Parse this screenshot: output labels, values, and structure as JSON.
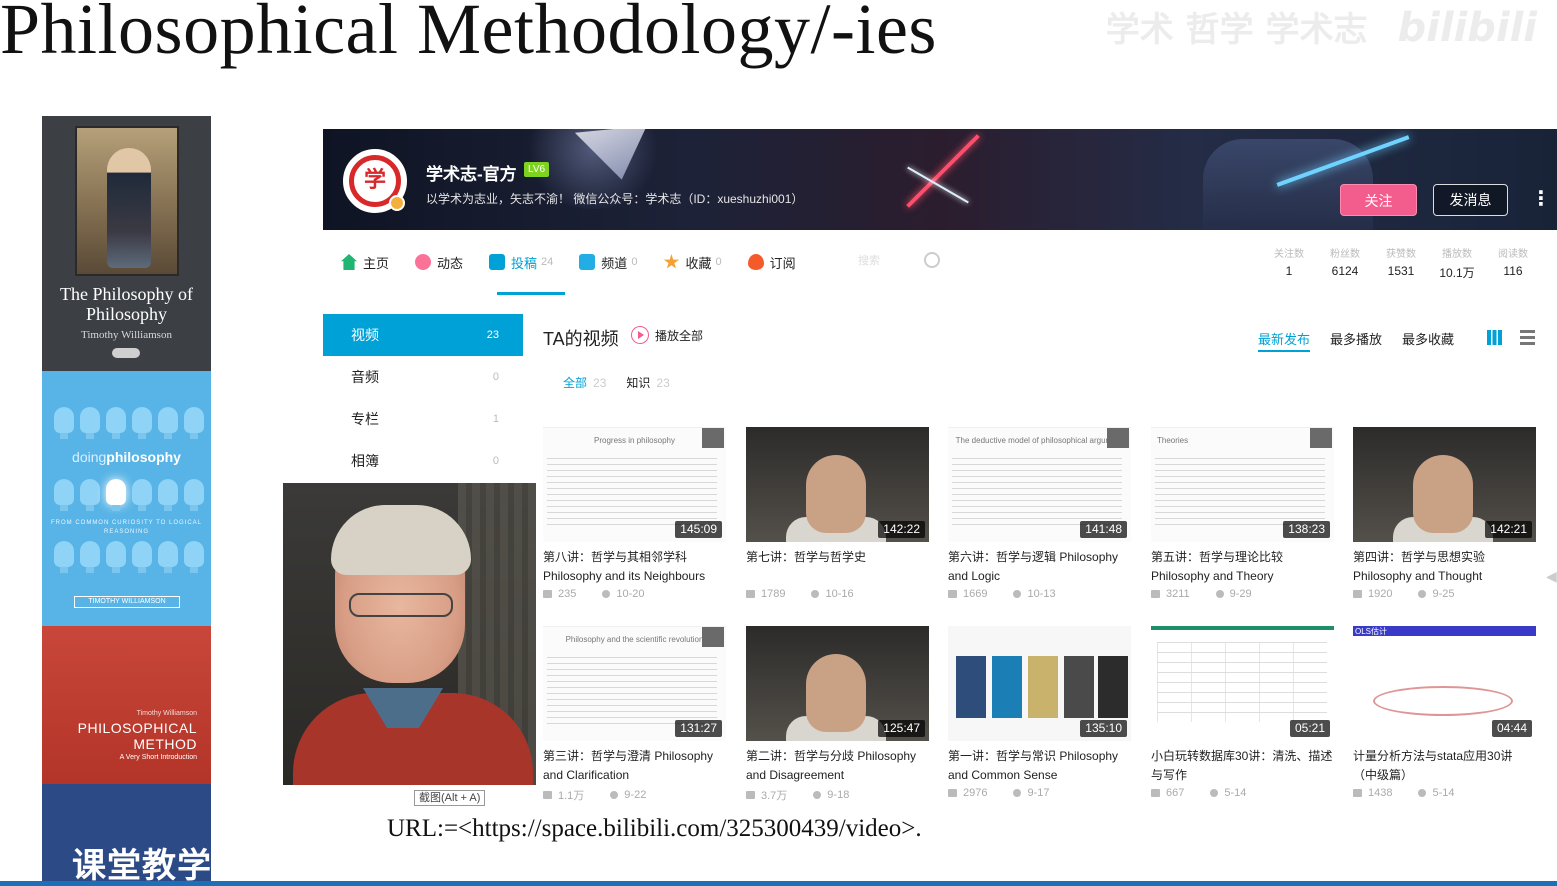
{
  "slide": {
    "title": "Philosophical Methodology/-ies",
    "watermark_text": "学术 哲学 学术志",
    "watermark_logo": "bilibili",
    "url_line": "URL:=<https://space.bilibili.com/325300439/video>."
  },
  "books": [
    {
      "title": "The Philosophy of Philosophy",
      "author": "Timothy Williamson"
    },
    {
      "title_prefix": "doing",
      "title_main": "philosophy",
      "subtitle": "FROM COMMON CURIOSITY TO LOGICAL REASONING",
      "author": "TIMOTHY WILLIAMSON"
    },
    {
      "author": "Timothy Williamson",
      "title": "PHILOSOPHICAL METHOD",
      "subtitle": "A Very Short Introduction"
    },
    {
      "title": "课堂教学"
    }
  ],
  "channel": {
    "avatar_char": "学",
    "name": "学术志-官方",
    "level": "LV6",
    "sign": "以学术为志业，矢志不渝！ 微信公众号：学术志（ID：xueshuzhi001）",
    "follow_label": "关注",
    "message_label": "发消息",
    "more_label": "⋮"
  },
  "nav": {
    "items": [
      {
        "label": "主页",
        "count": "",
        "icon": "home-icon",
        "active": false
      },
      {
        "label": "动态",
        "count": "",
        "icon": "dynamic-icon",
        "active": false
      },
      {
        "label": "投稿",
        "count": "24",
        "icon": "post-icon",
        "active": true
      },
      {
        "label": "频道",
        "count": "0",
        "icon": "channel-icon",
        "active": false
      },
      {
        "label": "收藏",
        "count": "0",
        "icon": "favorite-icon",
        "active": false
      },
      {
        "label": "订阅",
        "count": "",
        "icon": "subscribe-icon",
        "active": false
      }
    ],
    "search_placeholder": "搜索"
  },
  "stats": [
    {
      "label": "关注数",
      "value": "1"
    },
    {
      "label": "粉丝数",
      "value": "6124"
    },
    {
      "label": "获赞数",
      "value": "1531"
    },
    {
      "label": "播放数",
      "value": "10.1万"
    },
    {
      "label": "阅读数",
      "value": "116"
    }
  ],
  "sidebar": {
    "items": [
      {
        "label": "视频",
        "count": "23",
        "active": true
      },
      {
        "label": "音频",
        "count": "0",
        "active": false
      },
      {
        "label": "专栏",
        "count": "1",
        "active": false
      },
      {
        "label": "相簿",
        "count": "0",
        "active": false
      }
    ]
  },
  "videos_header": {
    "title": "TA的视频",
    "play_all": "播放全部",
    "sort": [
      "最新发布",
      "最多播放",
      "最多收藏"
    ],
    "filters": [
      {
        "label": "全部",
        "count": "23"
      },
      {
        "label": "知识",
        "count": "23"
      }
    ]
  },
  "videos": [
    {
      "title": "第八讲：哲学与其相邻学科 Philosophy and its Neighbours",
      "duration": "145:09",
      "views": "235",
      "date": "10-20",
      "thumb": "doc",
      "thumb_text": "Progress in philosophy"
    },
    {
      "title": "第七讲：哲学与哲学史",
      "duration": "142:22",
      "views": "1789",
      "date": "10-16",
      "thumb": "video",
      "thumb_text": ""
    },
    {
      "title": "第六讲：哲学与逻辑 Philosophy and Logic",
      "duration": "141:48",
      "views": "1669",
      "date": "10-13",
      "thumb": "doc",
      "thumb_text": "The deductive model of philosophical argument"
    },
    {
      "title": "第五讲：哲学与理论比较 Philosophy and Theory",
      "duration": "138:23",
      "views": "3211",
      "date": "9-29",
      "thumb": "doc",
      "thumb_text": "Theories"
    },
    {
      "title": "第四讲：哲学与思想实验 Philosophy and Thought",
      "duration": "142:21",
      "views": "1920",
      "date": "9-25",
      "thumb": "video",
      "thumb_text": ""
    },
    {
      "title": "第三讲：哲学与澄清 Philosophy and Clarification",
      "duration": "131:27",
      "views": "1.1万",
      "date": "9-22",
      "thumb": "doc",
      "thumb_text": "Philosophy and the scientific revolution"
    },
    {
      "title": "第二讲：哲学与分歧 Philosophy and Disagreement",
      "duration": "125:47",
      "views": "3.7万",
      "date": "9-18",
      "thumb": "video",
      "thumb_text": ""
    },
    {
      "title": "第一讲：哲学与常识 Philosophy and Common Sense",
      "duration": "135:10",
      "views": "2976",
      "date": "9-17",
      "thumb": "books",
      "thumb_text": ""
    },
    {
      "title": "小白玩转数据库30讲：清洗、描述与写作",
      "duration": "05:21",
      "views": "667",
      "date": "5-14",
      "thumb": "table",
      "thumb_text": ""
    },
    {
      "title": "计量分析方法与stata应用30讲（中级篇）",
      "duration": "04:44",
      "views": "1438",
      "date": "5-14",
      "thumb": "math",
      "thumb_text": "OLS估计"
    }
  ],
  "snip_hint": "截图(Alt + A)",
  "colors": {
    "accent": "#00a1d6",
    "follow": "#f25d8e",
    "bottom_bar": "#1d6fb8"
  }
}
